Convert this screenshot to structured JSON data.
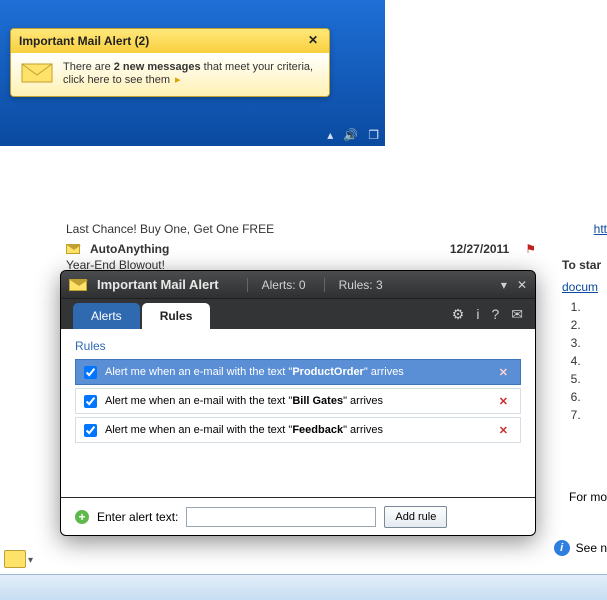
{
  "toast": {
    "title": "Important Mail Alert (2)",
    "line_pre": "There are ",
    "line_bold": "2 new messages",
    "line_post": " that meet your criteria, click here to see them"
  },
  "background_mail": {
    "subject_above": "Last Chance! Buy One, Get One FREE",
    "from": "AutoAnything",
    "date": "12/27/2011",
    "subject_below": "Year-End Blowout!"
  },
  "right_panel": {
    "ht": "htt",
    "heading": "To star",
    "link": "docum",
    "footer": "For mo",
    "info": "See n"
  },
  "modal": {
    "title": "Important Mail Alert",
    "alerts_label": "Alerts: 0",
    "rules_label": "Rules: 3",
    "tabs": {
      "alerts": "Alerts",
      "rules": "Rules"
    },
    "section": "Rules",
    "rule_prefix": "Alert me when an e-mail with the text ",
    "rule_suffix": " arrives",
    "rules": [
      {
        "keyword": "ProductOrder",
        "selected": true
      },
      {
        "keyword": "Bill Gates",
        "selected": false
      },
      {
        "keyword": "Feedback",
        "selected": false
      }
    ],
    "footer": {
      "label": "Enter alert text:",
      "button": "Add rule"
    }
  }
}
